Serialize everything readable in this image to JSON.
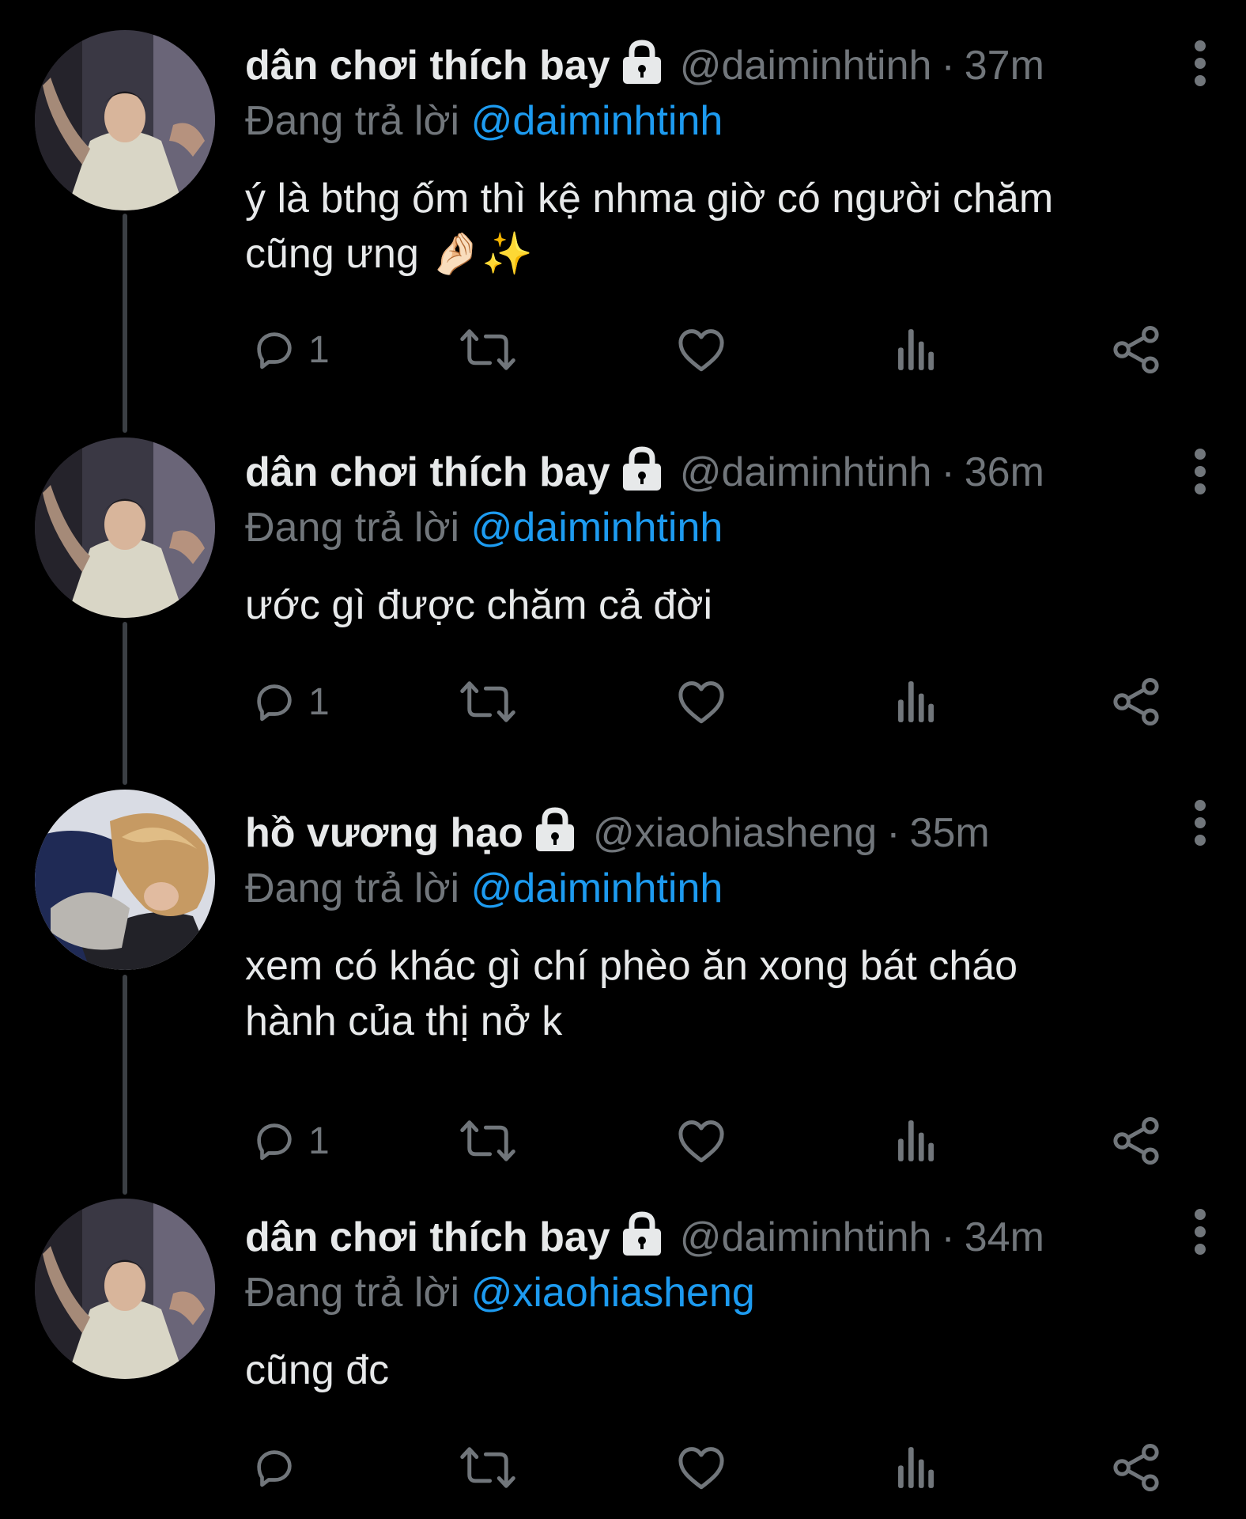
{
  "colors": {
    "background": "#000000",
    "text": "#e7e9ea",
    "muted": "#71767b",
    "accent": "#1d9bf0",
    "connector": "#3b3f44"
  },
  "tweets": [
    {
      "display_name": "dân chơi thích bay",
      "handle": "@daiminhtinh",
      "separator": "·",
      "time": "37m",
      "reply_prefix": "Đang trả lời",
      "reply_to": "@daiminhtinh",
      "text": "ý là bthg ốm thì kệ nhma giờ có người chăm\ncũng ưng 🤌🏻✨",
      "reply_count": "1",
      "locked_icon": "lock-icon",
      "avatar": "avatar-dan-choi"
    },
    {
      "display_name": "dân chơi thích bay",
      "handle": "@daiminhtinh",
      "separator": "·",
      "time": "36m",
      "reply_prefix": "Đang trả lời",
      "reply_to": "@daiminhtinh",
      "text": "ước gì được chăm cả đời",
      "reply_count": "1",
      "locked_icon": "lock-icon",
      "avatar": "avatar-dan-choi"
    },
    {
      "display_name": "hồ vương hạo",
      "handle": "@xiaohiasheng",
      "separator": "·",
      "time": "35m",
      "reply_prefix": "Đang trả lời",
      "reply_to": "@daiminhtinh",
      "text": "xem có khác gì chí phèo ăn xong bát cháo\nhành của thị nở k",
      "reply_count": "1",
      "locked_icon": "lock-icon",
      "avatar": "avatar-ho-vuong-hao"
    },
    {
      "display_name": "dân chơi thích bay",
      "handle": "@daiminhtinh",
      "separator": "·",
      "time": "34m",
      "reply_prefix": "Đang trả lời",
      "reply_to": "@xiaohiasheng",
      "text": "cũng đc",
      "reply_count": "",
      "locked_icon": "lock-icon",
      "avatar": "avatar-dan-choi"
    }
  ]
}
